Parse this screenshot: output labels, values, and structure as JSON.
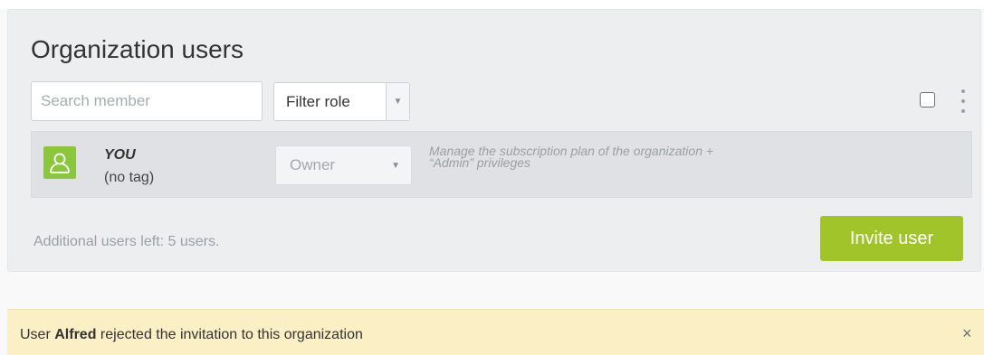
{
  "panel": {
    "title": "Organization users",
    "search": {
      "placeholder": "Search member",
      "value": ""
    },
    "filter": {
      "label": "Filter role"
    }
  },
  "users": [
    {
      "name": "YOU",
      "tag": "(no tag)",
      "role": "Owner",
      "role_description_line1": "Manage the subscription plan of the organization +",
      "role_description_line2": "“Admin” privileges",
      "avatar_icon": "user-icon"
    }
  ],
  "footer": {
    "users_left": "Additional users left: 5 users.",
    "invite_label": "Invite user"
  },
  "notification": {
    "prefix": "User ",
    "user": "Alfred",
    "suffix": " rejected the invitation to this organization",
    "close": "×"
  },
  "colors": {
    "accent": "#a2c42b",
    "avatar": "#8cc63f",
    "notice_bg": "#fbefc6"
  }
}
